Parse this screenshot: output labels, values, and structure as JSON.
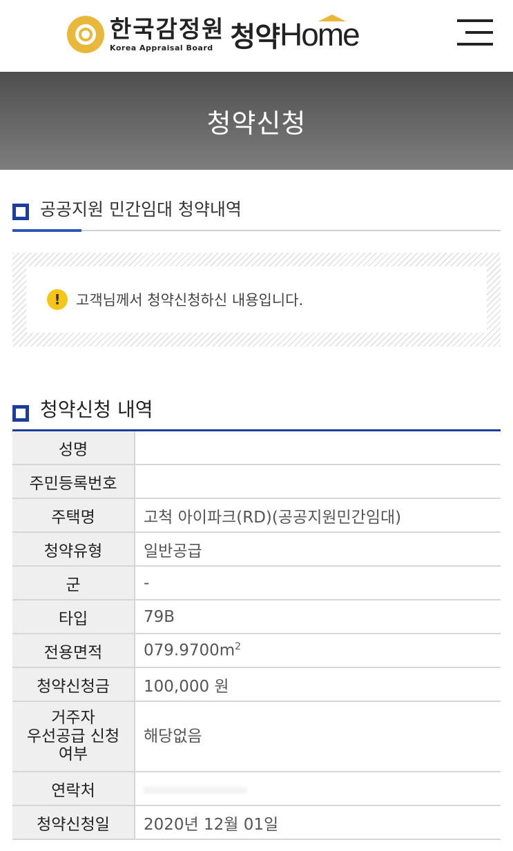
{
  "header": {
    "logo_kr": "한국감정원",
    "logo_en": "Korea Appraisal Board",
    "service_kr": "청약",
    "service_en": "Home",
    "menu_icon": "hamburger-menu-icon"
  },
  "banner": {
    "title": "청약신청"
  },
  "section1": {
    "title": "공공지원 민간임대 청약내역"
  },
  "notice": {
    "icon": "exclamation-icon",
    "text": "고객님께서 청약신청하신 내용입니다."
  },
  "section2": {
    "title": "청약신청 내역"
  },
  "details": [
    {
      "label": "성명",
      "value": ""
    },
    {
      "label": "주민등록번호",
      "value": ""
    },
    {
      "label": "주택명",
      "value": "고척 아이파크(RD)(공공지원민간임대)"
    },
    {
      "label": "청약유형",
      "value": "일반공급"
    },
    {
      "label": "군",
      "value": "-"
    },
    {
      "label": "타입",
      "value": "79B"
    },
    {
      "label": "전용면적",
      "value": "079.9700m",
      "unit_sup": "2"
    },
    {
      "label": "청약신청금",
      "value": "100,000 원"
    },
    {
      "label_lines": [
        "거주자",
        "우선공급 신청",
        "여부"
      ],
      "value": "해당없음"
    },
    {
      "label": "연락처",
      "value": ""
    },
    {
      "label": "청약신청일",
      "value": "2020년 12월 01일"
    }
  ],
  "colors": {
    "accent": "#1a3d9e",
    "logo_gold": "#e9b83a",
    "warning": "#f5c518"
  }
}
